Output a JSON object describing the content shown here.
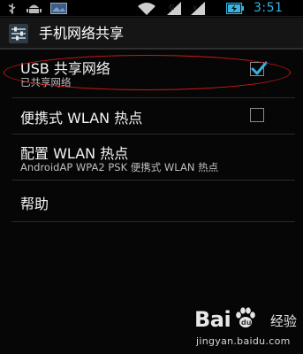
{
  "status_bar": {
    "time": "3:51",
    "icons": [
      "usb-icon",
      "android-debug-icon",
      "notification-image-icon",
      "wifi-icon",
      "signal-icon",
      "signal-icon",
      "battery-charging-icon"
    ],
    "accent_color": "#33b5e5"
  },
  "action_bar": {
    "title": "手机网络共享",
    "icon": "settings-sliders-icon"
  },
  "settings": [
    {
      "title": "USB 共享网络",
      "summary": "已共享网络",
      "checked": true
    },
    {
      "title": "便携式 WLAN 热点",
      "checked": false
    },
    {
      "title": "配置 WLAN 热点",
      "summary": "AndroidAP WPA2 PSK 便携式 WLAN 热点"
    },
    {
      "title": "帮助"
    }
  ],
  "annotation": {
    "color": "#d01818"
  },
  "watermark": {
    "brand": "Bai",
    "brand_suffix": "经验",
    "url": "jingyan.baidu.com"
  }
}
